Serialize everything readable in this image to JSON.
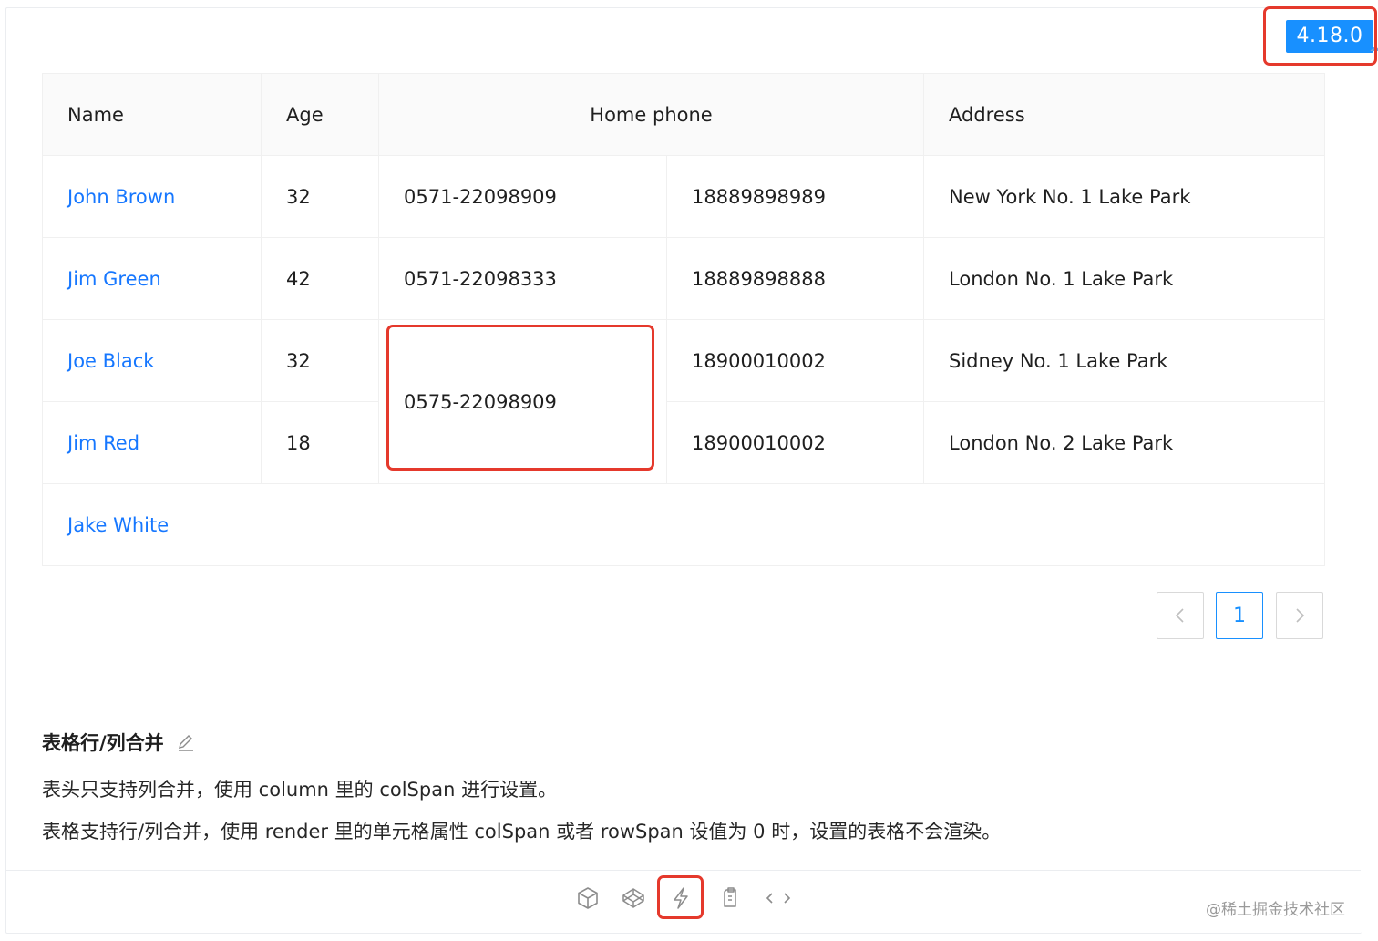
{
  "version_badge": "4.18.0",
  "table": {
    "headers": {
      "name": "Name",
      "age": "Age",
      "home_phone": "Home phone",
      "address": "Address"
    },
    "rows": [
      {
        "name": "John Brown",
        "age": "32",
        "tel": "0571-22098909",
        "phone": "18889898989",
        "address": "New York No. 1 Lake Park"
      },
      {
        "name": "Jim Green",
        "age": "42",
        "tel": "0571-22098333",
        "phone": "18889898888",
        "address": "London No. 1 Lake Park"
      },
      {
        "name": "Joe Black",
        "age": "32",
        "tel": "0575-22098909",
        "phone": "18900010002",
        "address": "Sidney No. 1 Lake Park"
      },
      {
        "name": "Jim Red",
        "age": "18",
        "tel": "0575-22098909",
        "phone": "18900010002",
        "address": "London No. 2 Lake Park"
      },
      {
        "name": "Jake White",
        "age": "",
        "tel": "",
        "phone": "",
        "address": ""
      }
    ]
  },
  "pagination": {
    "prev": "<",
    "current_page": "1",
    "next": ">"
  },
  "description": {
    "title": "表格行/列合并",
    "line1": "表头只支持列合并，使用 column 里的 colSpan 进行设置。",
    "line2": "表格支持行/列合并，使用 render 里的单元格属性 colSpan 或者 rowSpan 设值为 0 时，设置的表格不会渲染。"
  },
  "actions": [
    "codesandbox-icon",
    "codepen-icon",
    "stackblitz-icon",
    "copy-icon",
    "code-expand-icon"
  ],
  "watermark": "@稀土掘金技术社区",
  "colors": {
    "link": "#1677ff",
    "primary": "#1890ff",
    "highlight_frame": "#e5392c"
  }
}
